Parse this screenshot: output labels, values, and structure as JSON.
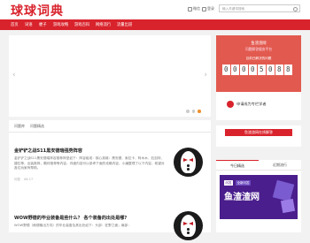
{
  "header": {
    "logo": "球球词典",
    "links": [
      "微信",
      "登录"
    ],
    "search_placeholder": "输入关键词搜索"
  },
  "nav": {
    "items": [
      "首页",
      "词语",
      "梗子",
      "游戏攻略",
      "游戏百科",
      "网络流行",
      "流量出道"
    ]
  },
  "carousel": {
    "prev": "‹",
    "next": "›",
    "dots": 3,
    "active_dot": 2
  },
  "tabs": [
    "问题库",
    "问题精选"
  ],
  "articles": [
    {
      "title": "金铲铲之战S11黑安德瑞强势阵容",
      "desc": "金铲铲之战S11黑安德瑞阵容推荐阵型如下：阵容组成：核心英雄：黑安德、索拉卡、阿木木、厄加特、婕拉等，出装推荐，羁绊推荐等内容，详细内容可以参考下面的攻略内容，小编整理了以下内容，希望对各位玩家有帮助。",
      "meta": [
        "问答",
        "06-17"
      ]
    },
    {
      "title": "WOW野德的毕业装备是些什么？ 各个装备的出处是哪?",
      "desc": "WOW野德（熊德输出方向）的毕业装备及其出处如下：头部：狂野之面；肩部：",
      "meta": []
    }
  ],
  "sidebar": {
    "promo_title": "鱼渣渣网",
    "promo_sub": "问题解答服务平台",
    "promo_count_label": "目前已解决的问题",
    "counter": [
      "0",
      "0",
      "0",
      "0",
      "5",
      "0",
      "8",
      "8"
    ],
    "apply_label": "申请成为专栏学者",
    "answer_button": "鱼渣渣网在线解答",
    "side_tabs": [
      "今日精选",
      "近期流行"
    ],
    "banner_tag1": "问答",
    "banner_tag2": "全新问答",
    "banner_title": "鱼渣渣网"
  }
}
